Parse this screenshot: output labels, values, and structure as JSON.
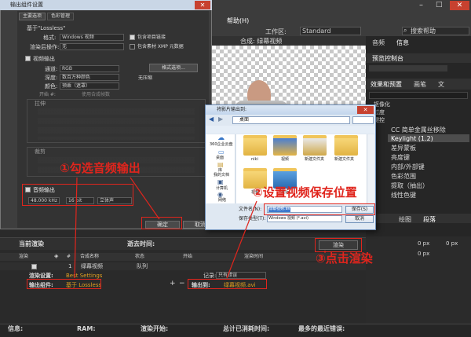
{
  "ae": {
    "menu_help": "帮助(H)",
    "menu_file": "文",
    "workspace_label": "工作区:",
    "workspace_value": "Standard",
    "search_help": "搜索帮助",
    "comp_tab": "合成: 绿幕视频",
    "right_tabs": [
      "音频",
      "信息"
    ],
    "preview_tab": "预览控制台",
    "effects_tab": "效果和预置",
    "paint_tab": "画笔",
    "text_tab": "文",
    "effects_items": [
      "抠像化",
      "过度",
      "键控",
      "CC 简单金属丝移除",
      "Keylight (1.2)",
      "差异蒙板",
      "亮度键",
      "内部/外部键",
      "色彩范围",
      "提取（抽出）",
      "线性色键"
    ],
    "paragraph_tabs": [
      "绘图",
      "段落"
    ],
    "px_values": [
      "0 px",
      "0 px",
      "0 px"
    ],
    "render_header_current": "当前渲染",
    "render_header_elapsed": "逝去时间:",
    "render_button": "渲染",
    "queue_cols": [
      "渲染",
      "#",
      "合成名称",
      "状态",
      "开始",
      "渲染时间"
    ],
    "queue_item_num": "1",
    "queue_item_name": "绿幕视频",
    "queue_item_status": "队列",
    "render_settings_label": "渲染设置:",
    "render_settings_value": "Best Settings",
    "output_module_label": "输出组件:",
    "output_module_value": "基于 Lossless",
    "log_label": "记录:",
    "log_value": "只有错误",
    "output_to_label": "输出到:",
    "output_to_value": "绿幕视频.avi",
    "status": [
      "信息:",
      "RAM:",
      "渲染开始:",
      "总计已消耗时间:",
      "最多的最近错误:"
    ]
  },
  "output_dialog": {
    "title": "输出组件设置",
    "tabs": [
      "主要选项",
      "色彩管理"
    ],
    "based_on": "基于\"Lossless\"",
    "format_label": "格式:",
    "format_value": "Windows 视频",
    "include_project_link": "包含项目链接",
    "post_render_label": "渲染后操作:",
    "post_render_value": "无",
    "include_xmp": "包含素材 XMP 元数据",
    "video_output": "视频输出",
    "channels_label": "通道:",
    "channels_value": "RGB",
    "format_options_button": "格式选项...",
    "depth_label": "深度:",
    "depth_value": "数百万种颜色",
    "codec_value": "无压缩",
    "color_label": "颜色:",
    "color_value": "预乘（遮罩）",
    "start_label": "开始 #:",
    "use_comp_frame": "使用合成帧数",
    "stretch_label": "拉伸",
    "crop_label": "裁剪",
    "audio_output": "音频输出",
    "audio_rate": "48.000 kHz",
    "audio_bits": "16 bit",
    "audio_channels": "立体声",
    "ok_button": "确定",
    "cancel_button": "取消"
  },
  "save_dialog": {
    "title": "将影片输出到:",
    "address": "桌面",
    "sidebar": [
      "360企业云盘",
      "桌面",
      "库",
      "我的文档",
      "计算机",
      "网络"
    ],
    "files": [
      "niki",
      "视频",
      "新建文件夹",
      "新建文件夹",
      "视频",
      "最近"
    ],
    "filename_label": "文件名(N):",
    "filename_value": "绿幕视频.avi",
    "filetype_label": "保存类型(T):",
    "filetype_value": "Windows 视频 (*.avi)",
    "save_button": "保存(S)",
    "cancel_button": "取消"
  },
  "annotations": {
    "a1": "①勾选音频输出",
    "a2": "②设置视频保存位置",
    "a3": "③点击渲染"
  },
  "colors": {
    "accent_red": "#e0251d",
    "link_orange": "#e0a020"
  }
}
